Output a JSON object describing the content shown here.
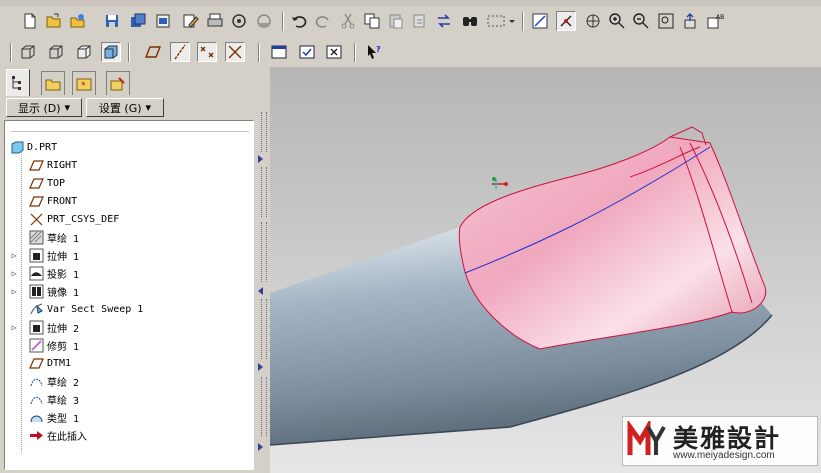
{
  "toolbar_main": {
    "icons": [
      "new-file-icon",
      "open-file-icon",
      "open-folder-icon",
      "save-icon",
      "save-copy-icon",
      "backup-icon",
      "rename-icon",
      "print-icon",
      "email-icon",
      "email-link-icon",
      "undo-icon",
      "redo-icon",
      "cut-icon",
      "copy-icon",
      "paste-icon",
      "paste-special-icon",
      "regenerate-icon",
      "find-icon",
      "selection-box-icon",
      "dropdown-icon",
      "sketch-view-icon",
      "spin-center-icon",
      "orient-icon",
      "zoom-in-icon",
      "zoom-out-icon",
      "refit-icon",
      "export-icon",
      "annotation-icon"
    ]
  },
  "toolbar_display": {
    "icons": [
      "wireframe-icon",
      "hidden-line-icon",
      "no-hidden-icon",
      "shading-icon",
      "datum-planes-icon",
      "datum-axes-icon",
      "datum-points-icon",
      "coordinate-systems-icon",
      "window-icon",
      "window-activate-icon",
      "window-close-icon",
      "context-help-icon"
    ]
  },
  "panel": {
    "tabs": [
      "model-tree-tab",
      "folder-browser-tab",
      "favorites-tab",
      "connections-tab"
    ],
    "show_button": "显示 (D)",
    "settings_button": "设置 (G)"
  },
  "tree": {
    "root": "D.PRT",
    "items": [
      {
        "label": "RIGHT",
        "icon": "datum-plane-icon",
        "expandable": false
      },
      {
        "label": "TOP",
        "icon": "datum-plane-icon",
        "expandable": false
      },
      {
        "label": "FRONT",
        "icon": "datum-plane-icon",
        "expandable": false
      },
      {
        "label": "PRT_CSYS_DEF",
        "icon": "csys-icon",
        "expandable": false
      },
      {
        "label": "草绘 1",
        "icon": "sketch-icon",
        "expandable": false
      },
      {
        "label": "拉伸 1",
        "icon": "extrude-icon",
        "expandable": true
      },
      {
        "label": "投影 1",
        "icon": "project-icon",
        "expandable": true
      },
      {
        "label": "镜像 1",
        "icon": "mirror-icon",
        "expandable": true
      },
      {
        "label": "Var Sect Sweep 1",
        "icon": "sweep-icon",
        "expandable": false
      },
      {
        "label": "拉伸 2",
        "icon": "extrude-icon",
        "expandable": true
      },
      {
        "label": "修剪 1",
        "icon": "trim-icon",
        "expandable": false
      },
      {
        "label": "DTM1",
        "icon": "datum-plane-icon",
        "expandable": false
      },
      {
        "label": "草绘 2",
        "icon": "sketch-curve-icon",
        "expandable": false
      },
      {
        "label": "草绘 3",
        "icon": "sketch-curve-icon",
        "expandable": false
      },
      {
        "label": "类型 1",
        "icon": "type-icon",
        "expandable": false
      },
      {
        "label": "在此插入",
        "icon": "insert-here-icon",
        "expandable": false
      }
    ]
  },
  "watermark": {
    "brand": "美雅設計",
    "url": "www.meiyadesign.com"
  },
  "colors": {
    "surface_pink": "#f2b6c8",
    "edge_red": "#d0103a",
    "tube_blue": "#a8b8c8",
    "curve_blue": "#2030d0"
  }
}
